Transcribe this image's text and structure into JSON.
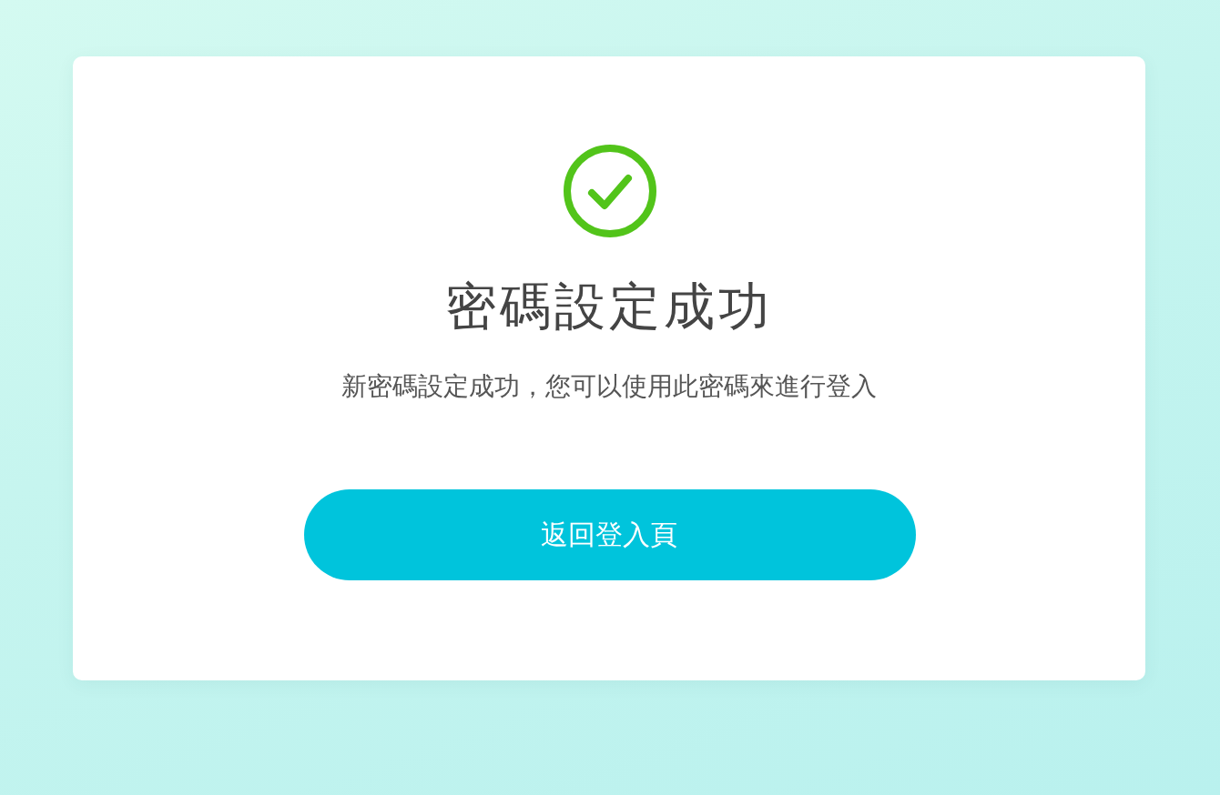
{
  "card": {
    "title": "密碼設定成功",
    "message": "新密碼設定成功，您可以使用此密碼來進行登入",
    "button": "返回登入頁"
  }
}
